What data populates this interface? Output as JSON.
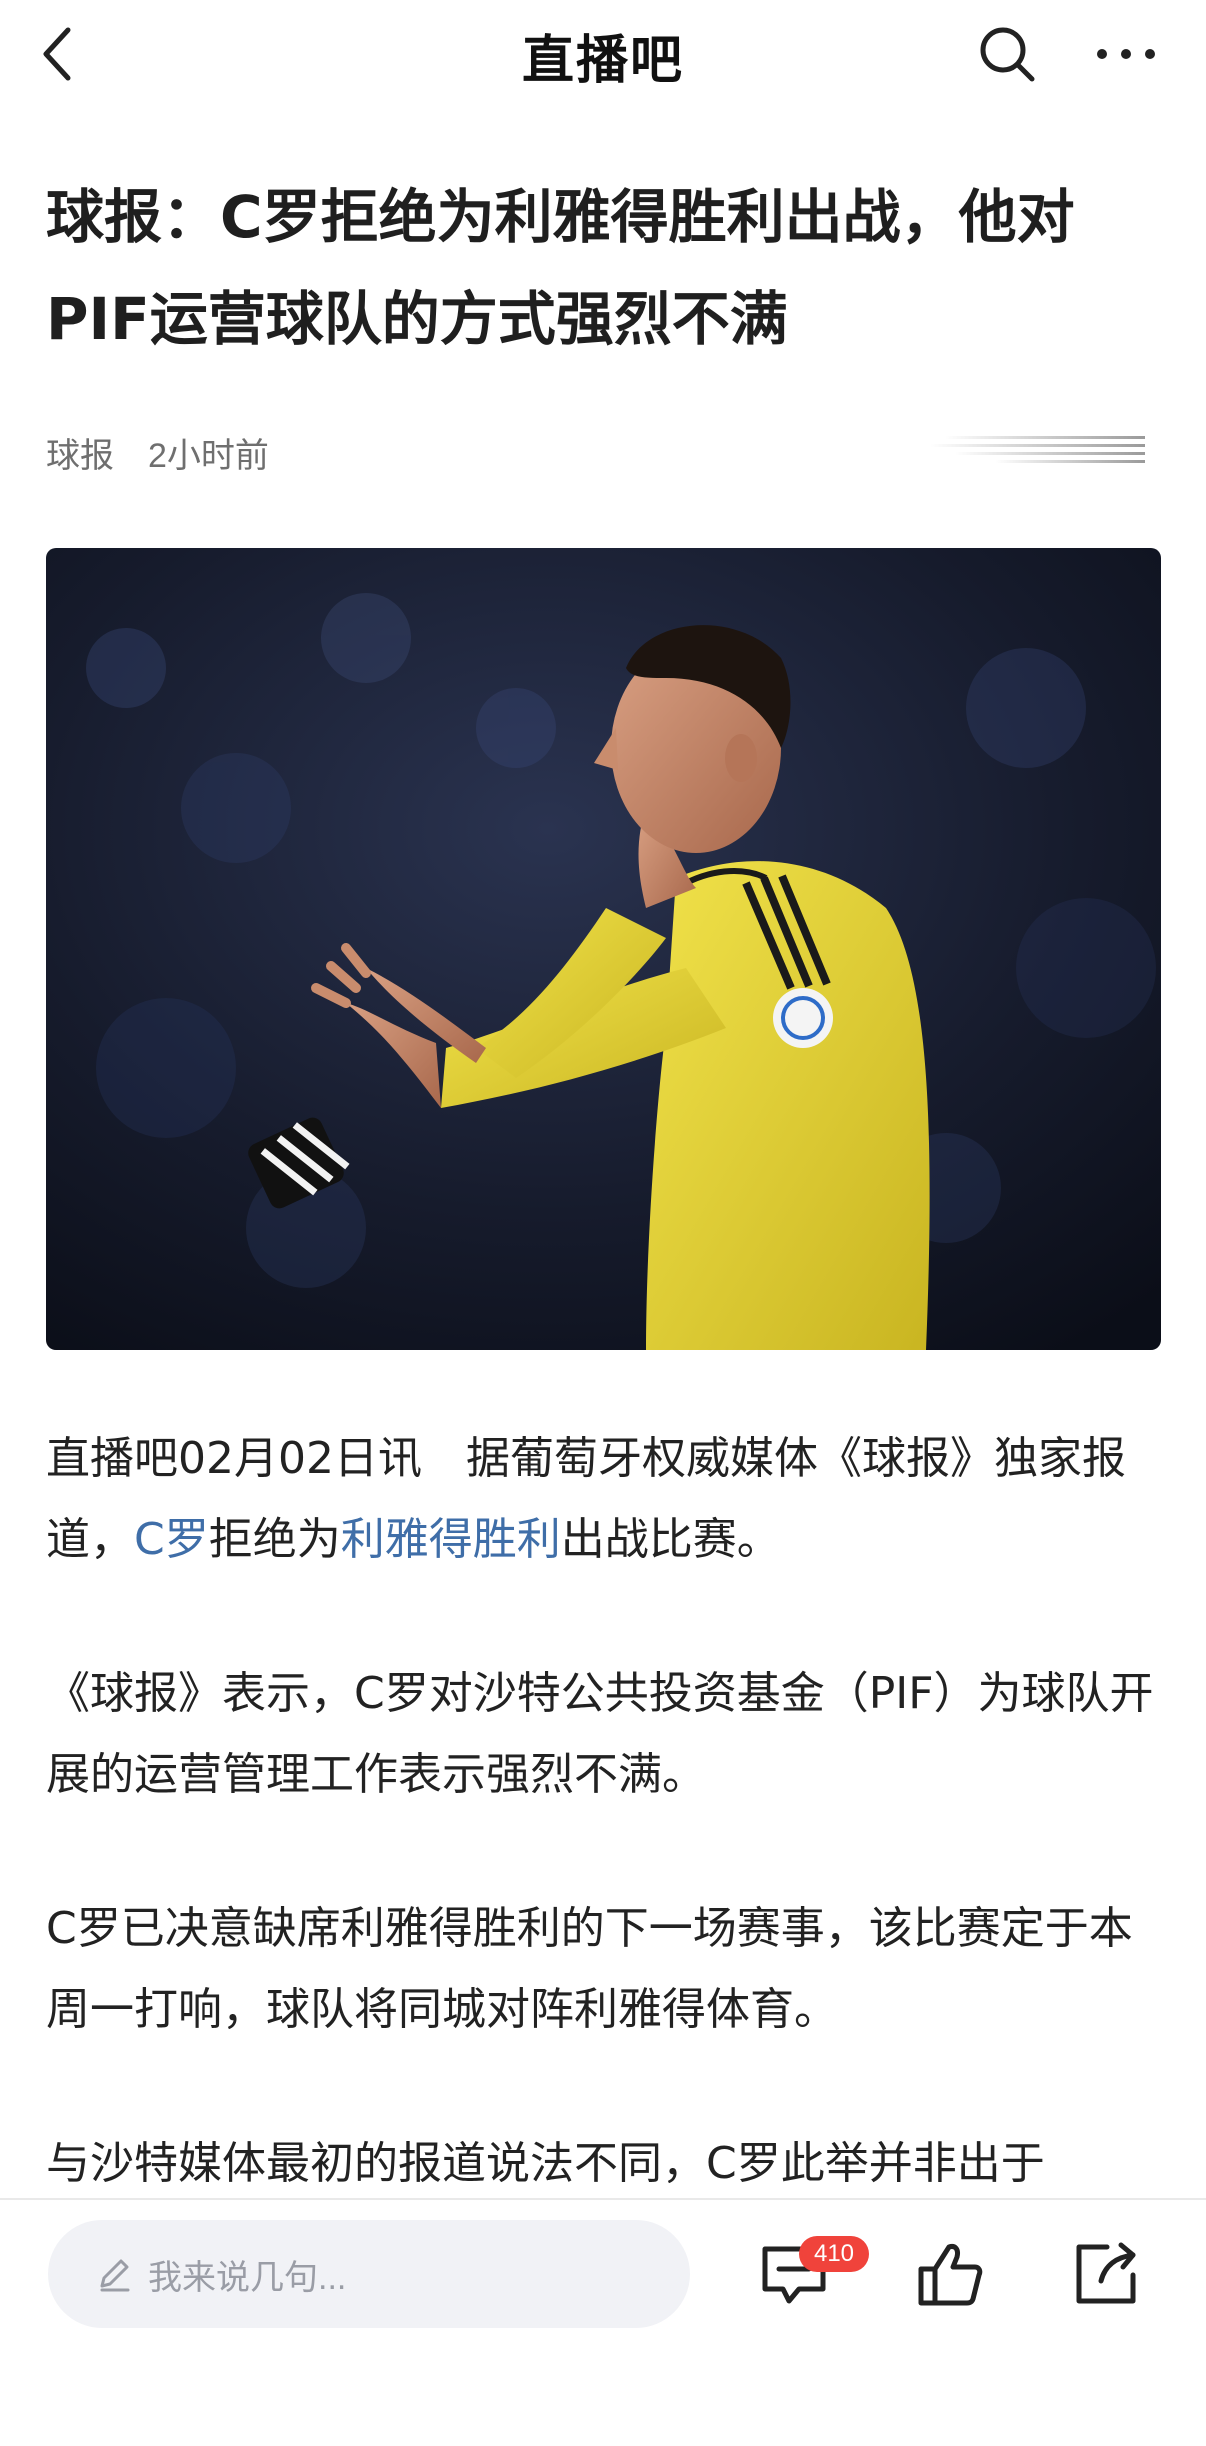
{
  "nav": {
    "logo": "直播吧",
    "back_icon": "chevron-left-icon",
    "search_icon": "search-icon",
    "more_icon": "more-dots-icon"
  },
  "article": {
    "title": "球报：C罗拒绝为利雅得胜利出战，他对PIF运营球队的方式强烈不满",
    "source": "球报",
    "time": "2小时前",
    "paragraphs": [
      {
        "p1_lead": "直播吧02月02日讯　据葡萄牙权威媒体《球报》独家报道，",
        "p1_link1": "C罗",
        "p1_mid": "拒绝为",
        "p1_link2": "利雅得胜利",
        "p1_tail": "出战比赛。"
      }
    ],
    "p2": "《球报》表示，C罗对沙特公共投资基金（PIF）为球队开展的运营管理工作表示强烈不满。",
    "p3": "C罗已决意缺席利雅得胜利的下一场赛事，该比赛定于本周一打响，球队将同城对阵利雅得体育。",
    "p4": "与沙特媒体最初的报道说法不同，C罗此举并非出于"
  },
  "bottom": {
    "comment_placeholder": "我来说几句...",
    "comment_count": "410",
    "icons": [
      "pen-icon",
      "comment-icon",
      "thumbs-up-icon",
      "share-icon"
    ]
  },
  "colors": {
    "link": "#3f6ea8",
    "badge": "#f0433b",
    "jersey": "#e8d43a"
  }
}
